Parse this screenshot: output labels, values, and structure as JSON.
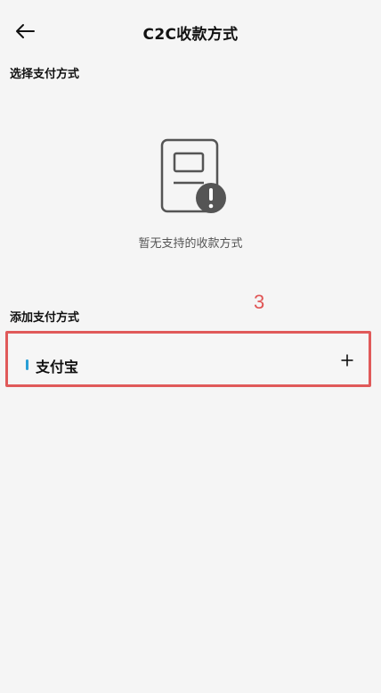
{
  "header": {
    "title": "C2C收款方式",
    "back_icon": "arrow-left-icon"
  },
  "sections": {
    "select_title": "选择支付方式",
    "empty_state": {
      "text": "暂无支持的收款方式",
      "icon": "document-warning-icon"
    },
    "add_title": "添加支付方式",
    "annotation_number": "3",
    "methods": [
      {
        "label": "支付宝",
        "indicator_color": "#2a9fd6",
        "action_icon": "plus-icon"
      }
    ]
  },
  "colors": {
    "background": "#f5f5f5",
    "highlight_border": "#e05a5a",
    "annotation": "#e05555"
  }
}
